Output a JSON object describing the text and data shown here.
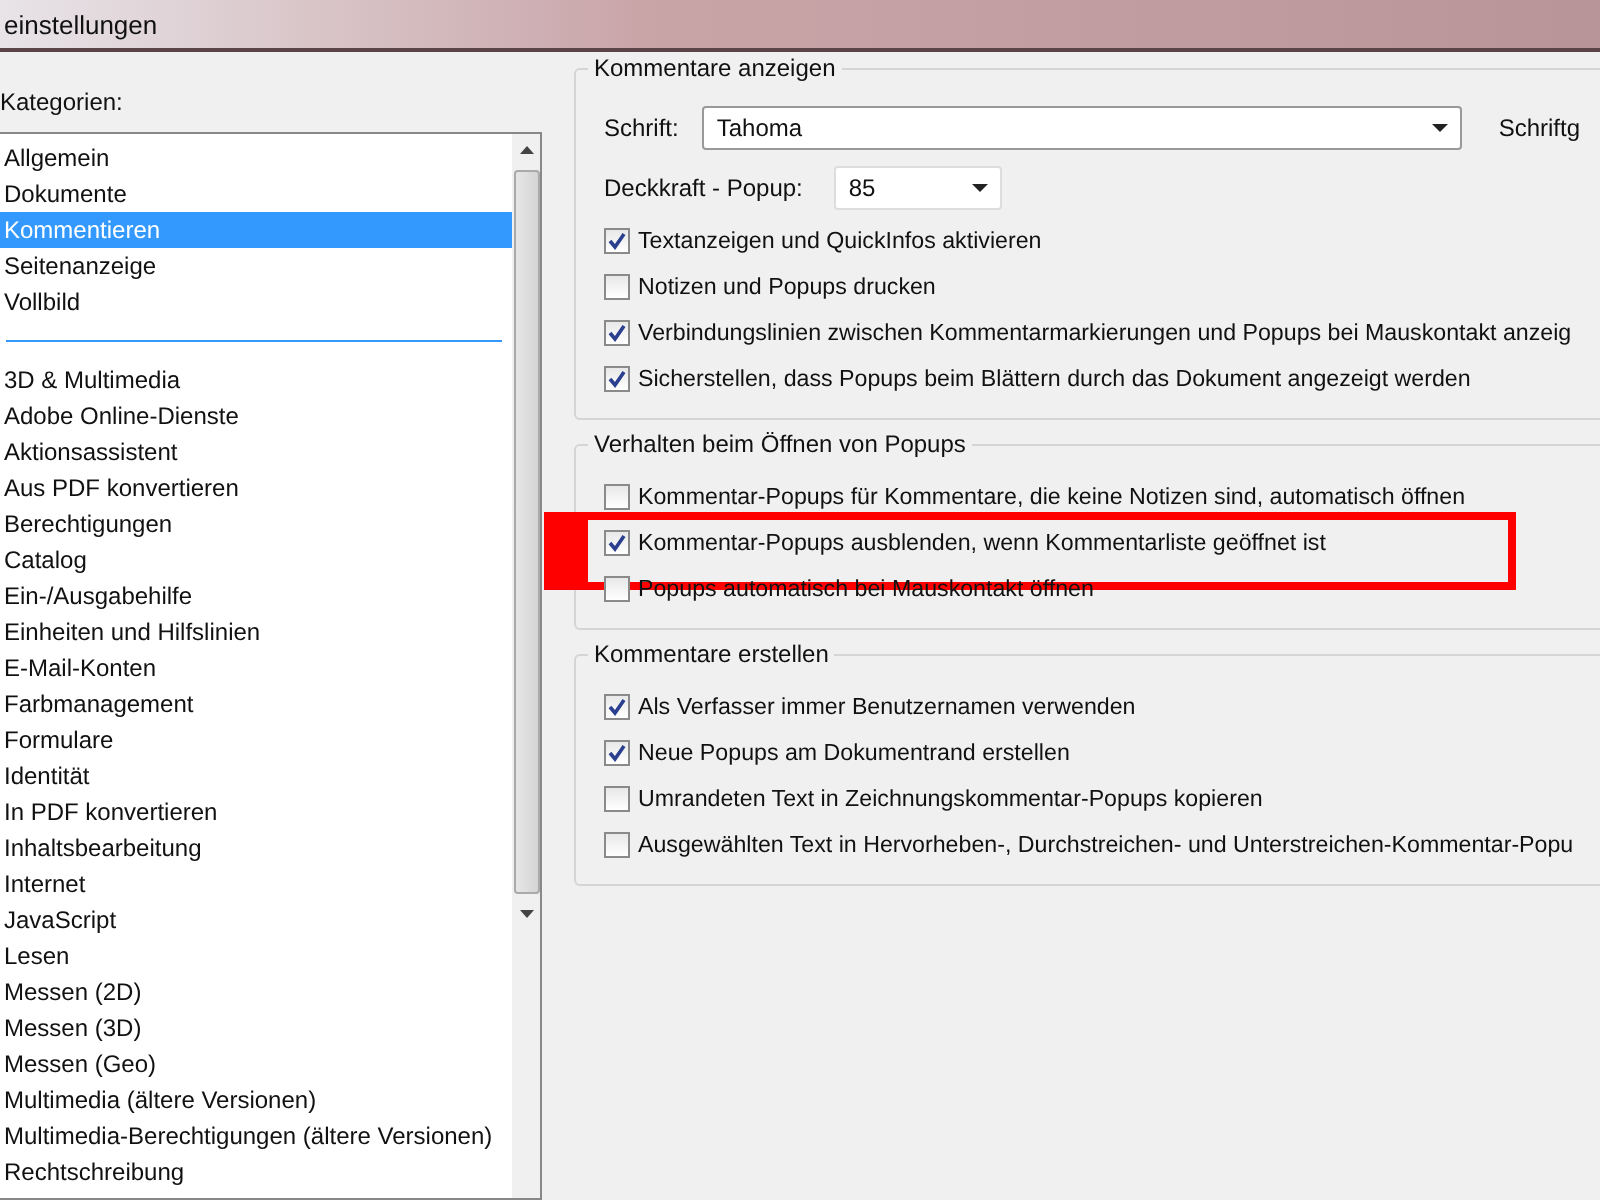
{
  "window": {
    "title": "einstellungen"
  },
  "categories": {
    "label": "Kategorien:",
    "groups": [
      {
        "items": [
          {
            "label": "Allgemein",
            "selected": false
          },
          {
            "label": "Dokumente",
            "selected": false
          },
          {
            "label": "Kommentieren",
            "selected": true
          },
          {
            "label": "Seitenanzeige",
            "selected": false
          },
          {
            "label": "Vollbild",
            "selected": false
          }
        ]
      },
      {
        "items": [
          {
            "label": "3D & Multimedia",
            "selected": false
          },
          {
            "label": "Adobe Online-Dienste",
            "selected": false
          },
          {
            "label": "Aktionsassistent",
            "selected": false
          },
          {
            "label": "Aus PDF konvertieren",
            "selected": false
          },
          {
            "label": "Berechtigungen",
            "selected": false
          },
          {
            "label": "Catalog",
            "selected": false
          },
          {
            "label": "Ein-/Ausgabehilfe",
            "selected": false
          },
          {
            "label": "Einheiten und Hilfslinien",
            "selected": false
          },
          {
            "label": "E-Mail-Konten",
            "selected": false
          },
          {
            "label": "Farbmanagement",
            "selected": false
          },
          {
            "label": "Formulare",
            "selected": false
          },
          {
            "label": "Identität",
            "selected": false
          },
          {
            "label": "In PDF konvertieren",
            "selected": false
          },
          {
            "label": "Inhaltsbearbeitung",
            "selected": false
          },
          {
            "label": "Internet",
            "selected": false
          },
          {
            "label": "JavaScript",
            "selected": false
          },
          {
            "label": "Lesen",
            "selected": false
          },
          {
            "label": "Messen (2D)",
            "selected": false
          },
          {
            "label": "Messen (3D)",
            "selected": false
          },
          {
            "label": "Messen (Geo)",
            "selected": false
          },
          {
            "label": "Multimedia (ältere Versionen)",
            "selected": false
          },
          {
            "label": "Multimedia-Berechtigungen (ältere Versionen)",
            "selected": false
          },
          {
            "label": "Rechtschreibung",
            "selected": false
          }
        ]
      }
    ]
  },
  "sections": [
    {
      "title": "Kommentare anzeigen",
      "fields": [
        {
          "kind": "font",
          "label": "Schrift:",
          "value": "Tahoma",
          "side_label": "Schriftg"
        },
        {
          "kind": "opacity",
          "label": "Deckkraft - Popup:",
          "value": "85"
        }
      ],
      "options": [
        {
          "label": "Textanzeigen und QuickInfos aktivieren",
          "checked": true
        },
        {
          "label": "Notizen und Popups drucken",
          "checked": false
        },
        {
          "label": "Verbindungslinien zwischen Kommentarmarkierungen und Popups bei Mauskontakt anzeig",
          "checked": true
        },
        {
          "label": "Sicherstellen, dass Popups beim Blättern durch das Dokument angezeigt werden",
          "checked": true
        }
      ]
    },
    {
      "title": "Verhalten beim Öffnen von Popups",
      "options": [
        {
          "label": "Kommentar-Popups für Kommentare, die keine Notizen sind, automatisch öffnen",
          "checked": false
        },
        {
          "label": "Kommentar-Popups ausblenden, wenn Kommentarliste geöffnet ist",
          "checked": true,
          "highlighted": true
        },
        {
          "label": "Popups automatisch bei Mauskontakt öffnen",
          "checked": false
        }
      ]
    },
    {
      "title": "Kommentare erstellen",
      "options": [
        {
          "label": "Als Verfasser immer Benutzernamen verwenden",
          "checked": true
        },
        {
          "label": "Neue Popups am Dokumentrand erstellen",
          "checked": true
        },
        {
          "label": "Umrandeten Text in Zeichnungskommentar-Popups kopieren",
          "checked": false
        },
        {
          "label": "Ausgewählten Text in Hervorheben-, Durchstreichen- und Unterstreichen-Kommentar-Popu",
          "checked": false
        }
      ]
    }
  ]
}
